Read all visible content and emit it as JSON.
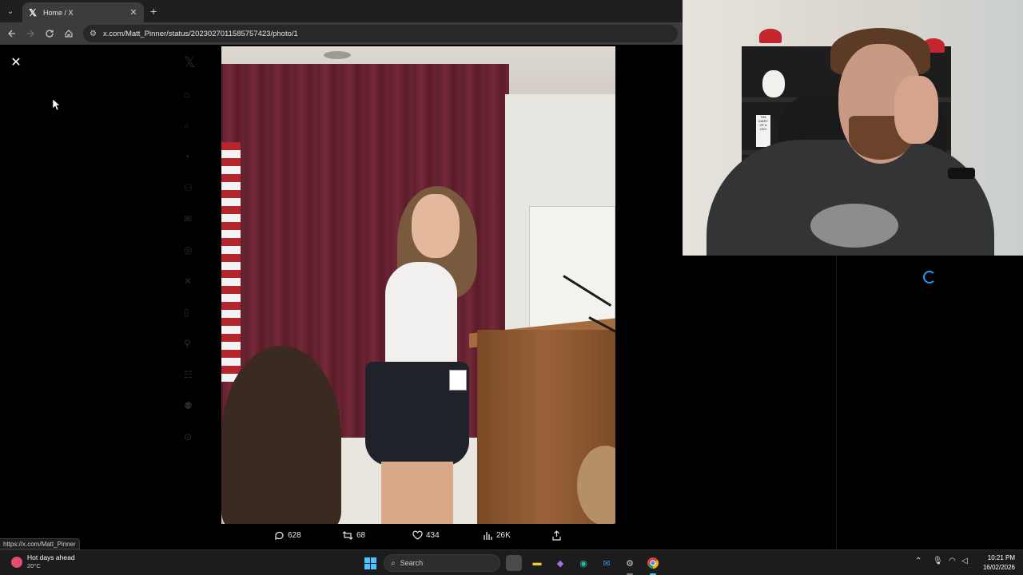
{
  "browser": {
    "tab": {
      "title": "Home / X",
      "favicon": "𝕏"
    },
    "url": "x.com/Matt_Pinner/status/2023027011585757423/photo/1",
    "status_url": "https://x.com/Matt_Pinner"
  },
  "viewer": {
    "close_label": "✕"
  },
  "actions": {
    "replies": "628",
    "reposts": "68",
    "likes": "434",
    "views": "26K"
  },
  "taskbar": {
    "weather_title": "Hot days ahead",
    "weather_temp": "20°C",
    "search_placeholder": "Search",
    "time": "10:21 PM",
    "date": "16/02/2026"
  },
  "webcam": {
    "book_title": "THE DIARY OF A CEO"
  },
  "colors": {
    "accent": "#1d9bf0",
    "background": "#000000"
  }
}
